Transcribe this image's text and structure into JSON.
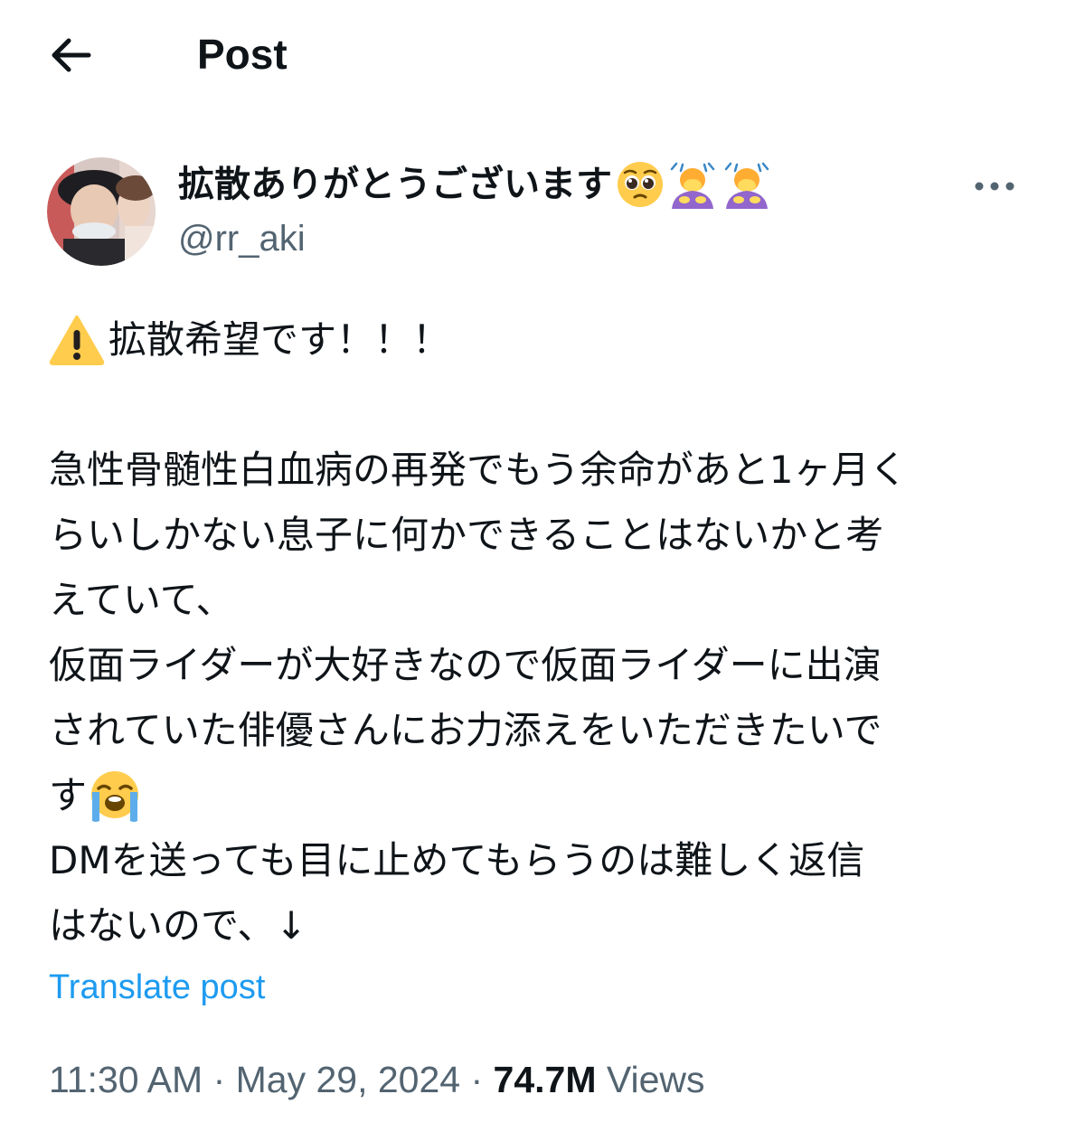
{
  "header": {
    "title": "Post",
    "back_icon": "arrow-left-icon"
  },
  "author": {
    "display_name": "拡散ありがとうございます",
    "name_emojis": [
      "pleading-face-icon",
      "person-bowing-icon",
      "person-bowing-icon"
    ],
    "handle": "@rr_aki",
    "more_icon": "more-horizontal-icon"
  },
  "post": {
    "warning_icon": "warning-icon",
    "line1": "拡散希望です！！！",
    "line2": "急性骨髄性白血病の再発でもう余命があと1ヶ月く",
    "line3": "らいしかない息子に何かできることはないかと考",
    "line4": "えていて、",
    "line5": "仮面ライダーが大好きなので仮面ライダーに出演",
    "line6": "されていた俳優さんにお力添えをいただきたいで",
    "line7": "す",
    "crying_icon": "loudly-crying-face-icon",
    "line8": "DMを送っても目に止めてもらうのは難しく返信",
    "line9": "はないので、↓"
  },
  "translate_label": "Translate post",
  "meta": {
    "time": "11:30 AM",
    "separator": " · ",
    "date": "May 29, 2024",
    "views_count": "74.7M",
    "views_label": " Views"
  },
  "colors": {
    "text": "#0f1419",
    "secondary": "#536471",
    "link": "#1d9bf0"
  }
}
